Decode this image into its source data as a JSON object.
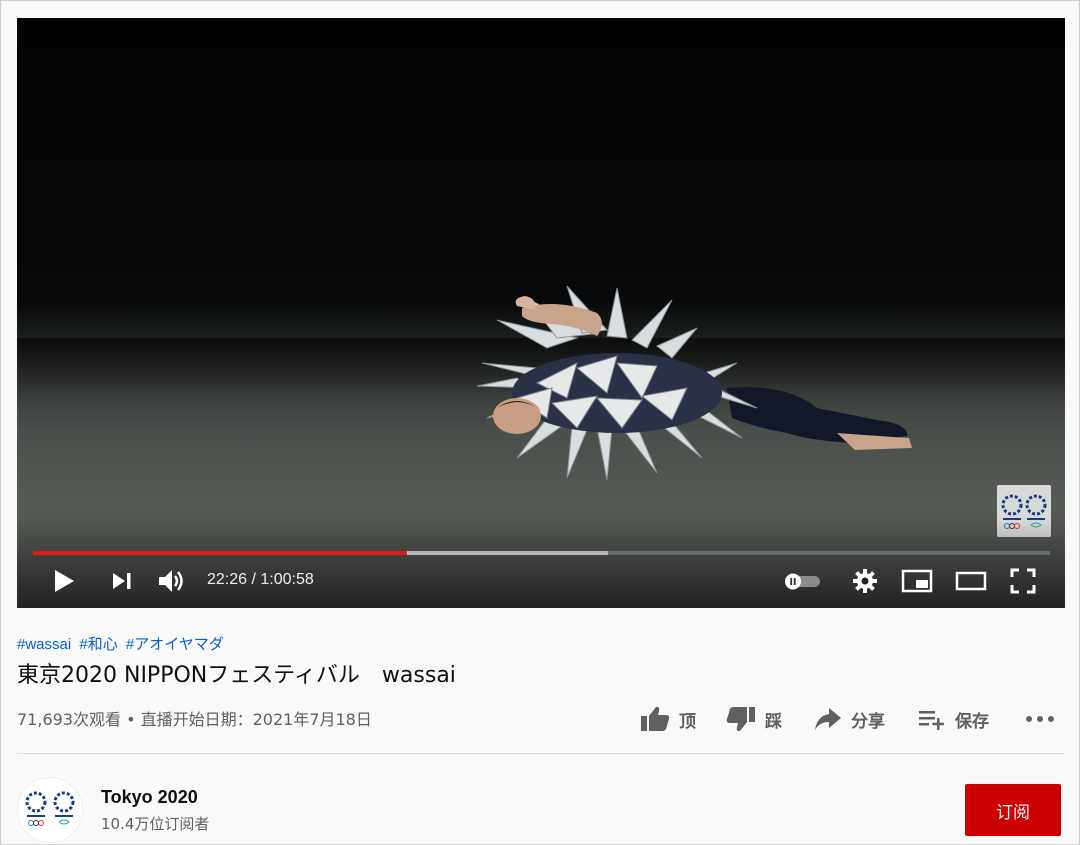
{
  "player": {
    "current_time": "22:26",
    "separator": " / ",
    "duration": "1:00:58",
    "played_fraction": 0.368,
    "buffered_fraction": 0.565,
    "autoplay_on": false
  },
  "video": {
    "hashtags": [
      "#wassai",
      "#和心",
      "#アオイヤマダ"
    ],
    "title": "東京2020 NIPPONフェスティバル　wassai",
    "meta": "71,693次观看 • 直播开始日期：2021年7月18日"
  },
  "actions": {
    "like_label": "顶",
    "dislike_label": "踩",
    "share_label": "分享",
    "save_label": "保存"
  },
  "channel": {
    "name": "Tokyo 2020",
    "subscribers": "10.4万位订阅者",
    "subscribe_label": "订阅"
  },
  "colors": {
    "accent_red": "#cc0000",
    "progress_red": "#e01b1b",
    "hashtag_blue": "#065fd4",
    "emblem_blue": "#1d3a8a"
  },
  "icons": [
    "play-icon",
    "next-icon",
    "volume-icon",
    "autoplay-toggle",
    "settings-icon",
    "miniplayer-icon",
    "theater-icon",
    "fullscreen-icon",
    "thumbs-up-icon",
    "thumbs-down-icon",
    "share-icon",
    "save-playlist-icon",
    "more-icon"
  ]
}
